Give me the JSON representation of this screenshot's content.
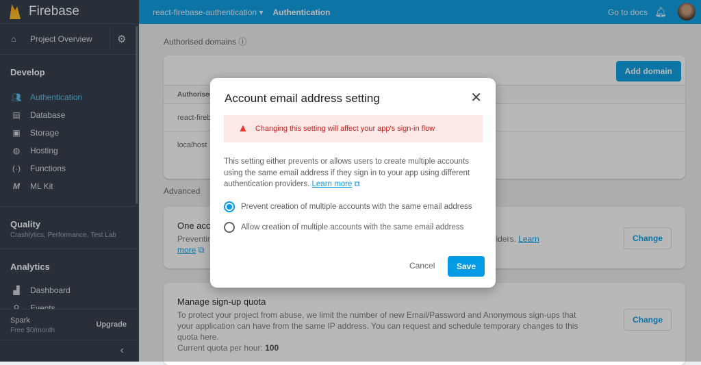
{
  "brand": "Firebase",
  "sidebar": {
    "project_overview": "Project Overview",
    "develop": "Develop",
    "develop_items": [
      {
        "label": "Authentication",
        "icon": "people-icon"
      },
      {
        "label": "Database",
        "icon": "database-icon"
      },
      {
        "label": "Storage",
        "icon": "folder-image-icon"
      },
      {
        "label": "Hosting",
        "icon": "globe-icon"
      },
      {
        "label": "Functions",
        "icon": "functions-icon"
      },
      {
        "label": "ML Kit",
        "icon": "ml-icon"
      }
    ],
    "quality": "Quality",
    "quality_sub": "Crashlytics, Performance, Test Lab",
    "analytics": "Analytics",
    "analytics_items": [
      {
        "label": "Dashboard"
      },
      {
        "label": "Events"
      }
    ],
    "plan": "Spark",
    "plan_sub": "Free $0/month",
    "upgrade": "Upgrade"
  },
  "topbar": {
    "project": "react-firebase-authentication",
    "section": "Authentication",
    "docs": "Go to docs"
  },
  "main": {
    "domains_label": "Authorised domains",
    "add_domain": "Add domain",
    "col_header": "Authorised",
    "domains": [
      "react-fireb",
      "localhost"
    ],
    "advanced": "Advanced",
    "one_account": {
      "title": "One acc",
      "text": "Preventin",
      "text_tail": "nt authentication providers.",
      "learn": "Learn",
      "more": "more",
      "change": "Change"
    },
    "quota": {
      "title": "Manage sign-up quota",
      "text": "To protect your project from abuse, we limit the number of new Email/Password and Anonymous sign-ups that your application can have from the same IP address. You can request and schedule temporary changes to this quota here.",
      "current_label": "Current quota per hour:",
      "current_value": "100",
      "change": "Change"
    }
  },
  "dialog": {
    "title": "Account email address setting",
    "warning": "Changing this setting will affect your app's sign-in flow",
    "description": "This setting either prevents or allows users to create multiple accounts using the same email address if they sign in to your app using different authentication providers.",
    "learn_more": "Learn more",
    "options": [
      {
        "label": "Prevent creation of multiple accounts with the same email address",
        "selected": true
      },
      {
        "label": "Allow creation of multiple accounts with the same email address",
        "selected": false
      }
    ],
    "cancel": "Cancel",
    "save": "Save"
  }
}
